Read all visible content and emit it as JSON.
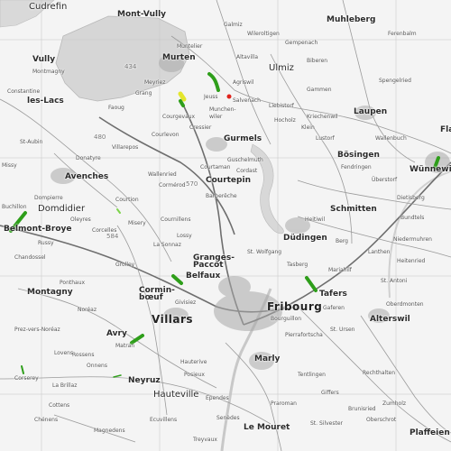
{
  "map": {
    "colors": {
      "background": "#f4f4f4",
      "lake": "#d6d6d6",
      "road": "#9a9a9a",
      "major_road": "#6e6e6e",
      "grid": "#c4c4c4",
      "highlight_green": "#2e9e1a",
      "highlight_yellow": "#e4e62c",
      "highlight_red": "#e0231c"
    },
    "labels": {
      "cudrefin": "Cudrefin",
      "mont_vully": "Mont-Vully",
      "galmiz": "Galmiz",
      "muhleberg": "Muhleberg",
      "vully": "Vully",
      "montmagny": "Montmagny",
      "murten": "Murten",
      "gempenach": "Gempenach",
      "spengelried": "Spengelried",
      "constantine": "Constantine",
      "les_lacs": "les-Lacs",
      "meyriez": "Meyriez",
      "salvenach": "Salvenach",
      "ulmiz": "Ulmiz",
      "gammen": "Gammen",
      "grang": "Grang",
      "muntelier": "Muntelier",
      "altavilla": "Altavilla",
      "biberen": "Biberen",
      "faoug": "Faoug",
      "courgevaux": "Courgevaux",
      "munchenwiler": "Munchen-\nwiler",
      "liebistorf": "Liebistorf",
      "kriechenwil": "Kriechenwil",
      "laupen": "Laupen",
      "bosingen": "Bösingen",
      "cressier": "Cressier",
      "gurmels": "Gurmels",
      "klein": "Klein",
      "st_aubin": "St-Aubin",
      "missy": "Missy",
      "avenches": "Avenches",
      "villarepos": "Villarepos",
      "wallenried": "Wallenried",
      "courtepin": "Courtepin",
      "wunnewil": "Wünnewil",
      "flamatt": "Fla",
      "dompierre": "Dompierre",
      "domdidier": "Domdidier",
      "courtion": "Courtion",
      "misery": "Misery",
      "belmont_broye": "Belmont-Broye",
      "russy": "Russy",
      "cournillens": "Cournillens",
      "la_sonnaz": "La Sonnaz",
      "granges_paccot": "Granges-\nPaccot",
      "belfaux": "Belfaux",
      "dudingen": "Düdingen",
      "schmitten": "Schmitten",
      "tafers": "Tafers",
      "montagny": "Montagny",
      "grolley": "Grolley",
      "corminboeuf": "Cormin-\nbœuf",
      "givisiez": "Givisiez",
      "villars": "Villars",
      "fribourg": "Fribourg",
      "alterswil": "Alterswil",
      "st_ursen": "St. Ursen",
      "avry": "Avry",
      "marly": "Marly",
      "corserey": "Corserey",
      "neyruz": "Neyruz",
      "hauteville": "Hauteville",
      "rechthalten": "Rechthalten",
      "la_brillaz": "La Brillaz",
      "chenens": "Chénens",
      "le_mouret": "Le Mouret",
      "st_silvester": "St. Silvester",
      "plaffeien": "Plaffeien",
      "ependes": "Ependes",
      "giffers": "Giffers",
      "tentlingen": "Tentlingen",
      "oberschrot": "Oberschrot",
      "heitenried": "Heitenried",
      "st_antoni": "St. Antoni",
      "oberdmonten": "Oberdmonten",
      "niedermuhren": "Niedermuhren",
      "bundtels": "Bundtels",
      "dietisberg": "Dietisberg",
      "noreaz": "Noréaz",
      "ponthaux": "Ponthaux",
      "prez": "Prez-vers-Noréaz",
      "matran": "Matran",
      "rossens": "Rossens",
      "lossy": "Lossy",
      "pierrafortscha": "Pierrafortscha",
      "bourguillon": "Bourguillon",
      "gaferen": "Gaferen",
      "st_wolfgang": "St. Wolfgang",
      "tasberg": "Tasberg",
      "berg": "Berg",
      "lanthen": "Lanthen",
      "heitiwil": "Heitiwil",
      "wileroltigen": "Wileroltigen",
      "ferenbalm": "Ferenbalm",
      "agriswil": "Agriswil",
      "buchillon": "Buchillon",
      "guschelmuth": "Guschelmuth",
      "cordast": "Cordast",
      "barberêche": "Barberêche",
      "lovens": "Lovens",
      "cottens": "Cottens",
      "onnens": "Onnens",
      "senedes": "Senèdes",
      "praroman": "Praroman",
      "treyvaux": "Treyvaux",
      "brunisried": "Brunisried",
      "zumholz": "Zumholz",
      "mariahilf": "Mariahilf",
      "lustorf": "Lustorf",
      "fendringen": "Fendringen",
      "uberstorf": "Überstorf",
      "wallenbuch": "Wallenbuch",
      "hocholz": "Hocholz",
      "jeuss": "Jeuss",
      "courlevon": "Courlevon",
      "courtaman": "Courtaman",
      "cormerod": "Cormérod",
      "donatyre": "Donatyre",
      "oleyres": "Oleyres",
      "chandossel": "Chandossel",
      "corcelles": "Corcelles",
      "ecuvillens": "Ecuvillens",
      "magnedens": "Magnedens",
      "posieux": "Posieux",
      "hauterive": "Hauterive"
    },
    "lake_numbers": {
      "n434": "434",
      "n480": "480",
      "n584": "584",
      "n570": "570"
    }
  }
}
